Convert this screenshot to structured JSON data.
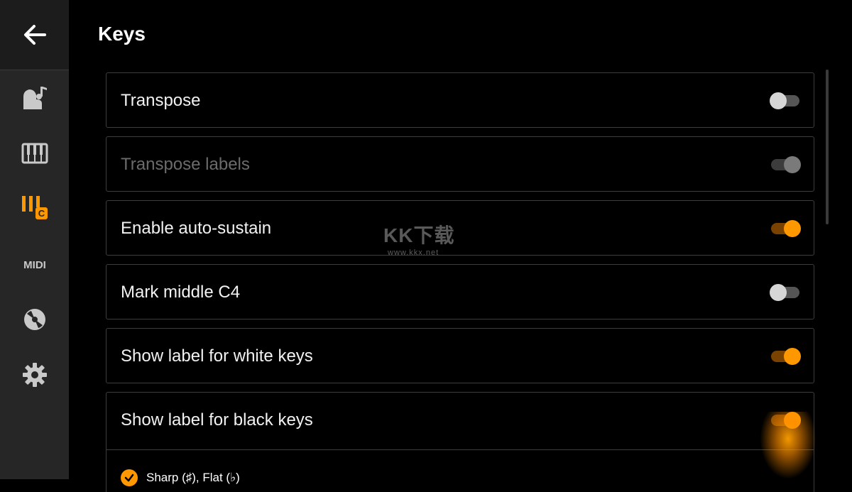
{
  "header": {
    "title": "Keys"
  },
  "sidebar": {
    "back_icon": "arrow-left-icon",
    "items": [
      {
        "icon": "piano-note-icon",
        "active": false
      },
      {
        "icon": "keyboard-icon",
        "active": false
      },
      {
        "icon": "keys-label-icon",
        "active": true,
        "badge": "C"
      },
      {
        "icon": "midi-icon",
        "active": false,
        "label": "MIDI"
      },
      {
        "icon": "disc-icon",
        "active": false
      },
      {
        "icon": "gear-icon",
        "active": false
      }
    ]
  },
  "settings": [
    {
      "label": "Transpose",
      "state": "off",
      "enabled": true
    },
    {
      "label": "Transpose labels",
      "state": "on",
      "enabled": false
    },
    {
      "label": "Enable auto-sustain",
      "state": "on",
      "enabled": true
    },
    {
      "label": "Mark middle C4",
      "state": "off",
      "enabled": true
    },
    {
      "label": "Show label for white keys",
      "state": "on",
      "enabled": true
    },
    {
      "label": "Show label for black keys",
      "state": "on",
      "enabled": true
    }
  ],
  "black_key_options": {
    "selected_label": "Sharp (♯), Flat (♭)"
  },
  "watermark": {
    "main": "KK下载",
    "url": "www.kkx.net"
  },
  "colors": {
    "accent": "#ff9800",
    "sidebar_bg": "#262626",
    "bg": "#000000"
  }
}
